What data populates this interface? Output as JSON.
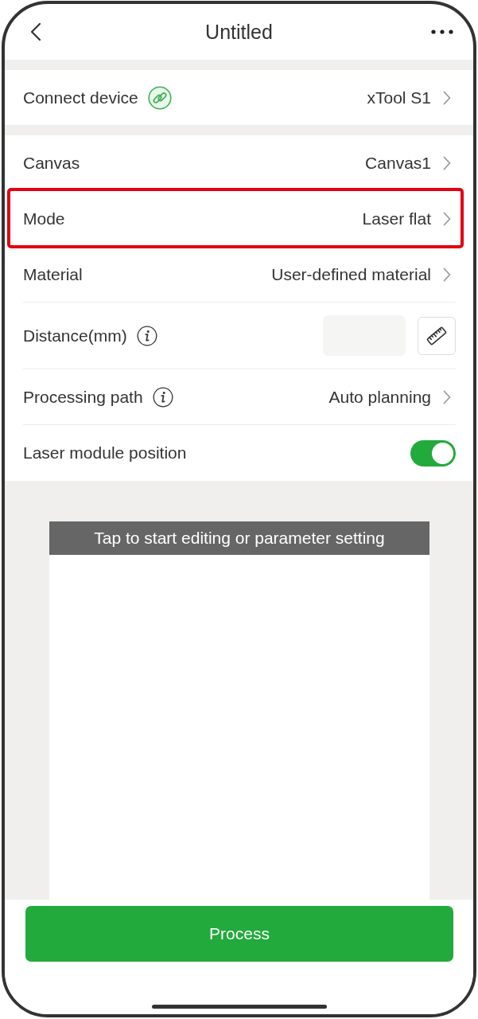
{
  "header": {
    "title": "Untitled"
  },
  "sections": [
    {
      "rows": [
        {
          "kind": "device",
          "label": "Connect device",
          "value": "xTool S1",
          "info": false,
          "highlighted": false
        }
      ]
    },
    {
      "rows": [
        {
          "kind": "select",
          "label": "Canvas",
          "value": "Canvas1",
          "info": false,
          "highlighted": false
        },
        {
          "kind": "select",
          "label": "Mode",
          "value": "Laser flat",
          "info": false,
          "highlighted": true
        },
        {
          "kind": "select",
          "label": "Material",
          "value": "User-defined material",
          "info": false,
          "highlighted": false
        },
        {
          "kind": "input",
          "label": "Distance(mm)",
          "info": true,
          "highlighted": false
        },
        {
          "kind": "select",
          "label": "Processing path",
          "value": "Auto planning",
          "info": true,
          "highlighted": false
        },
        {
          "kind": "toggle",
          "label": "Laser module position",
          "info": false,
          "highlighted": false,
          "on": true
        }
      ]
    }
  ],
  "canvas": {
    "banner": "Tap to start editing or parameter setting"
  },
  "process_button": {
    "label": "Process"
  }
}
